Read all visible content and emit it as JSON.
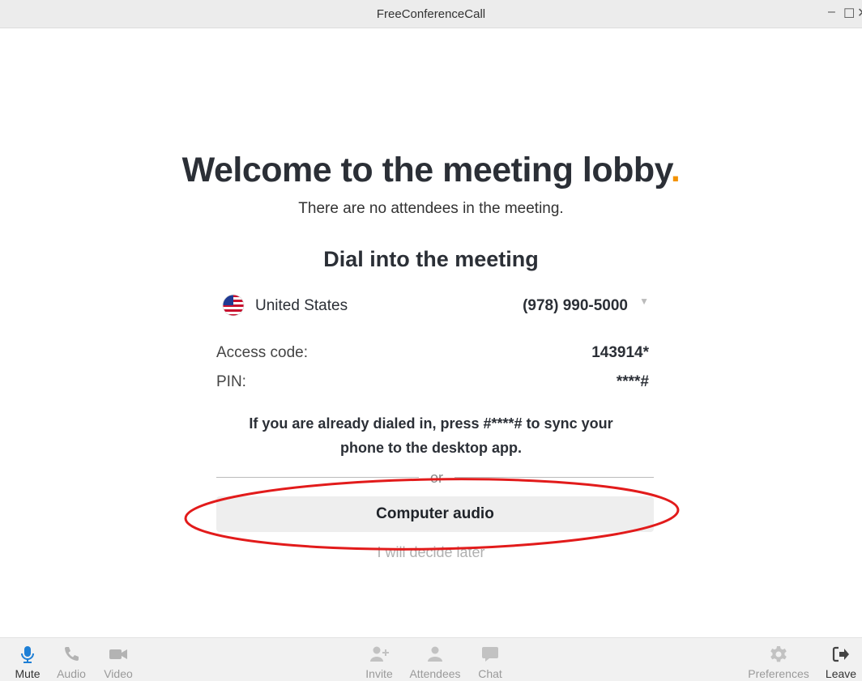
{
  "window": {
    "title": "FreeConferenceCall",
    "controls": {
      "minimize": "–",
      "maximize": "☐",
      "close": "✕"
    }
  },
  "lobby": {
    "headline": "Welcome to the meeting lobby",
    "headline_dot": ".",
    "subtitle": "There are no attendees in the meeting.",
    "dial_heading": "Dial into the meeting",
    "country": {
      "name": "United States",
      "phone": "(978) 990-5000",
      "flag_icon": "us-flag-icon"
    },
    "access_code": {
      "label": "Access code:",
      "value": "143914*"
    },
    "pin": {
      "label": "PIN:",
      "value": "****#"
    },
    "sync_note": "If you are already dialed in, press #****# to sync your phone to the desktop app.",
    "or_text": "or",
    "computer_audio_label": "Computer audio",
    "decide_later_label": "I will decide later"
  },
  "toolbar": {
    "left": [
      {
        "label": "Mute",
        "icon": "microphone-icon",
        "active": true
      },
      {
        "label": "Audio",
        "icon": "phone-icon"
      },
      {
        "label": "Video",
        "icon": "video-camera-icon"
      }
    ],
    "center": [
      {
        "label": "Invite",
        "icon": "add-user-icon"
      },
      {
        "label": "Attendees",
        "icon": "user-icon"
      },
      {
        "label": "Chat",
        "icon": "chat-bubble-icon"
      }
    ],
    "right": [
      {
        "label": "Preferences",
        "icon": "gear-icon"
      },
      {
        "label": "Leave",
        "icon": "leave-icon",
        "active": true
      }
    ]
  },
  "colors": {
    "accent_orange": "#f39200",
    "active_blue": "#1e7fd6",
    "highlight_red": "#e21b1b",
    "toolbar_bg": "#f1f1f1",
    "button_bg": "#eeeeee"
  }
}
